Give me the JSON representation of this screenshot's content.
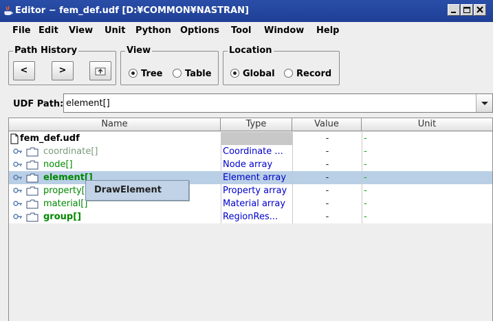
{
  "window": {
    "title": "Editor − fem_def.udf  [D:¥COMMON¥NASTRAN]"
  },
  "menu": [
    {
      "label": "File"
    },
    {
      "label": "Edit"
    },
    {
      "label": "View"
    },
    {
      "label": "Unit"
    },
    {
      "label": "Python"
    },
    {
      "label": "Options"
    },
    {
      "label": "Tool"
    },
    {
      "label": "Window"
    },
    {
      "label": "Help"
    }
  ],
  "path_history": {
    "legend": "Path History",
    "back_label": "<",
    "forward_label": ">",
    "up_icon": "folder-up-icon"
  },
  "view": {
    "legend": "View",
    "options": [
      {
        "label": "Tree",
        "selected": true
      },
      {
        "label": "Table",
        "selected": false
      }
    ]
  },
  "location": {
    "legend": "Location",
    "options": [
      {
        "label": "Global",
        "selected": true
      },
      {
        "label": "Record",
        "selected": false
      }
    ]
  },
  "udf_path": {
    "label": "UDF Path:",
    "value": "element[]"
  },
  "table": {
    "columns": [
      "Name",
      "Type",
      "Value",
      "Unit"
    ],
    "root": {
      "name": "fem_def.udf",
      "value": "-",
      "unit": "-"
    },
    "rows": [
      {
        "name": "coordinate[]",
        "type": "Coordinate ...",
        "value": "-",
        "unit": "-",
        "name_color": "#7a9a7a",
        "bold": false
      },
      {
        "name": "node[]",
        "type": "Node array",
        "value": "-",
        "unit": "-",
        "name_color": "#008800",
        "bold": false
      },
      {
        "name": "element[]",
        "type": "Element array",
        "value": "-",
        "unit": "-",
        "name_color": "#008800",
        "bold": true
      },
      {
        "name": "property[]",
        "type": "Property array",
        "value": "-",
        "unit": "-",
        "name_color": "#008800",
        "bold": false
      },
      {
        "name": "material[]",
        "type": "Material array",
        "value": "-",
        "unit": "-",
        "name_color": "#008800",
        "bold": false
      },
      {
        "name": "group[]",
        "type": "RegionRes...",
        "value": "-",
        "unit": "-",
        "name_color": "#008800",
        "bold": true
      }
    ]
  },
  "context_menu": {
    "item": "DrawElement"
  },
  "colors": {
    "titlebar": "#2a4ea8",
    "selection": "#b9cfe6",
    "type_text": "#0000cc",
    "unit_text": "#00aa00"
  }
}
